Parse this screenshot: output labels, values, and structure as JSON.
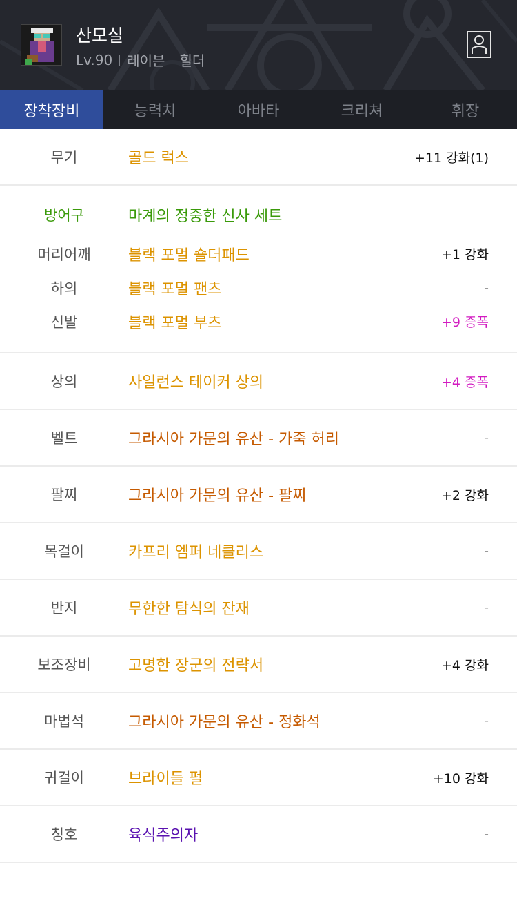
{
  "character": {
    "name": "산모실",
    "level": "Lv.90",
    "job": "레이븐",
    "class": "힐더"
  },
  "icons": {
    "profile": "person-icon",
    "avatar": "character-portrait"
  },
  "tabs": [
    {
      "label": "장착장비",
      "active": true
    },
    {
      "label": "능력치",
      "active": false
    },
    {
      "label": "아바타",
      "active": false
    },
    {
      "label": "크리쳐",
      "active": false
    },
    {
      "label": "휘장",
      "active": false
    }
  ],
  "weapon": {
    "slot": "무기",
    "name": "골드 럭스",
    "enhance": "+11 강화(1)"
  },
  "armor": {
    "label": "방어구",
    "set_name": "마계의 정중한 신사 세트",
    "items": [
      {
        "slot": "머리어깨",
        "name": "블랙 포멀 숄더패드",
        "enhance": "+1 강화"
      },
      {
        "slot": "하의",
        "name": "블랙 포멀 팬츠",
        "enhance": "-"
      },
      {
        "slot": "신발",
        "name": "블랙 포멀 부츠",
        "enhance": "+9 증폭"
      }
    ]
  },
  "equipment": [
    {
      "slot": "상의",
      "name": "사일런스 테이커 상의",
      "enhance": "+4 증폭"
    },
    {
      "slot": "벨트",
      "name": "그라시아 가문의 유산 - 가죽 허리",
      "enhance": "-"
    },
    {
      "slot": "팔찌",
      "name": "그라시아 가문의 유산 - 팔찌",
      "enhance": "+2 강화"
    },
    {
      "slot": "목걸이",
      "name": "카프리 엠퍼 네클리스",
      "enhance": "-"
    },
    {
      "slot": "반지",
      "name": "무한한 탐식의 잔재",
      "enhance": "-"
    },
    {
      "slot": "보조장비",
      "name": "고명한 장군의 전략서",
      "enhance": "+4 강화"
    },
    {
      "slot": "마법석",
      "name": "그라시아 가문의 유산 - 정화석",
      "enhance": "-"
    },
    {
      "slot": "귀걸이",
      "name": "브라이들 펄",
      "enhance": "+10 강화"
    },
    {
      "slot": "칭호",
      "name": "육식주의자",
      "enhance": "-"
    }
  ],
  "colors": {
    "header_bg": "#25272e",
    "tab_bar_bg": "#1d1f25",
    "active_tab": "#2f4d9b",
    "unique_item": "#dc9300",
    "epic_item": "#c55a00",
    "set_item": "#3a9a0a",
    "title_item": "#5a12b0",
    "amplify": "#d21ac0"
  }
}
